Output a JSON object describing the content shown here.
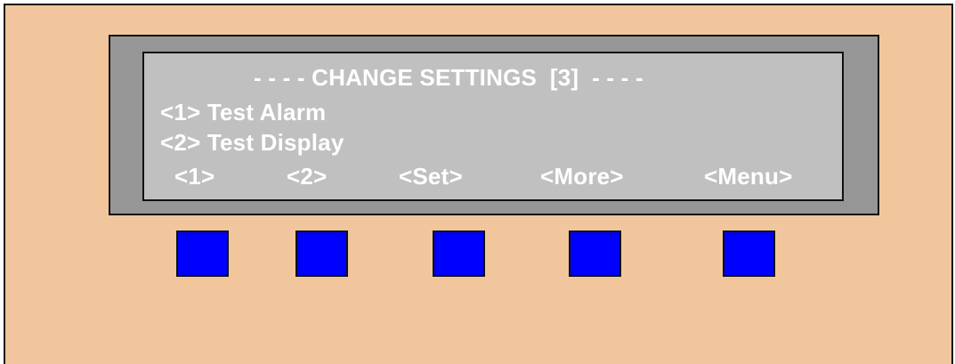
{
  "display": {
    "title": "- - - - CHANGE SETTINGS  [3]  - - - -",
    "lines": [
      "<1> Test Alarm",
      "<2> Test Display"
    ],
    "softkeys": [
      "<1>",
      "<2>",
      "<Set>",
      "<More>",
      "<Menu>"
    ]
  },
  "colors": {
    "panel": "#f2c69c",
    "bezel": "#969696",
    "screen": "#c0c0c0",
    "text": "#ffffff",
    "button": "#0000ff"
  }
}
